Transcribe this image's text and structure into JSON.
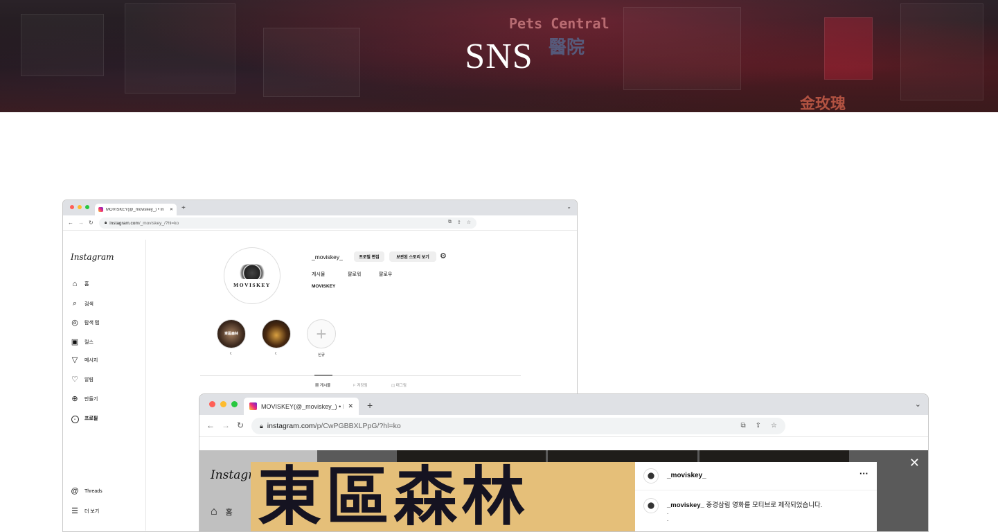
{
  "hero": {
    "title": "SNS",
    "signs": [
      "Pets Central",
      "醫院",
      "金玫瑰"
    ]
  },
  "window1": {
    "tab_title": "MOVISKEY(@_moviskey_) • In",
    "url_host": "instagram.com",
    "url_path": "/_moviskey_/?hl=ko",
    "sidebar": {
      "logo": "Instagram",
      "items": [
        {
          "icon": "home-icon",
          "label": "홈"
        },
        {
          "icon": "search-icon",
          "label": "검색"
        },
        {
          "icon": "compass-icon",
          "label": "탐색 탭"
        },
        {
          "icon": "reels-icon",
          "label": "릴스"
        },
        {
          "icon": "send-icon",
          "label": "메시지"
        },
        {
          "icon": "heart-icon",
          "label": "알림"
        },
        {
          "icon": "plus-square-icon",
          "label": "만들기"
        },
        {
          "icon": "avatar-icon",
          "label": "프로필"
        },
        {
          "icon": "threads-icon",
          "label": "Threads"
        },
        {
          "icon": "menu-icon",
          "label": "더 보기"
        }
      ]
    },
    "profile": {
      "brand": "MOVISKEY",
      "username": "_moviskey_",
      "edit_button": "프로필 편집",
      "archive_button": "보관된 스토리 보기",
      "stats": [
        "게시물",
        "팔로워",
        "팔로우"
      ],
      "bio_name": "MOVISKEY",
      "highlights": [
        {
          "label": "☾",
          "inner_text": "東區森林"
        },
        {
          "label": "☾",
          "inner_text": ""
        },
        {
          "label": "신규",
          "inner_text": ""
        }
      ],
      "tabs": [
        "게시물",
        "저장됨",
        "태그됨"
      ]
    }
  },
  "window2": {
    "tab_title": "MOVISKEY(@_moviskey_) • In",
    "url_host": "instagram.com",
    "url_path": "/p/CwPGBBXLPpG/?hl=ko",
    "sidebar": {
      "logo": "Instagram",
      "home_label": "홈"
    },
    "post": {
      "image_text": "東區森林",
      "username": "_moviskey_",
      "caption_user": "_moviskey_",
      "caption_text": "중경삼림 영화를 모티브로 제작되었습니다.",
      "caption_dots": [
        ".",
        "."
      ]
    }
  },
  "colors": {
    "accent_poster": "#e5bf79",
    "poster_text": "#151321",
    "hero_dark": "#1d1518"
  }
}
